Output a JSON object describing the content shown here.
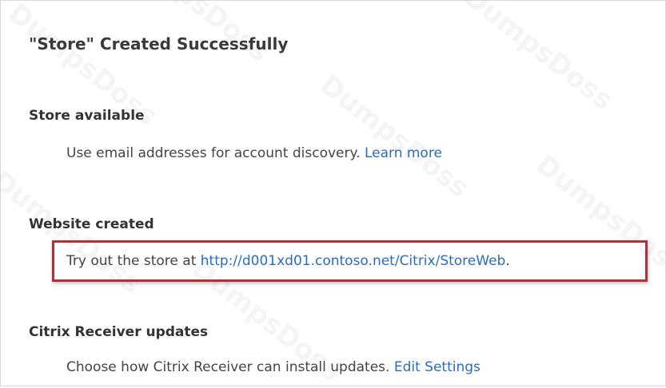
{
  "title": "\"Store\" Created Successfully",
  "sections": {
    "store": {
      "heading": "Store available",
      "text": "Use email addresses for account discovery.",
      "link": "Learn more"
    },
    "website": {
      "heading": "Website created",
      "text": "Try out the store at",
      "link": "http://d001xd01.contoso.net/Citrix/StoreWeb",
      "suffix": "."
    },
    "receiver": {
      "heading": "Citrix Receiver updates",
      "text": "Choose how Citrix Receiver can install updates.",
      "link": "Edit Settings"
    }
  },
  "watermark": "DumpsDoss",
  "colors": {
    "link": "#2a6cbd",
    "highlight_border": "#b1313a"
  }
}
